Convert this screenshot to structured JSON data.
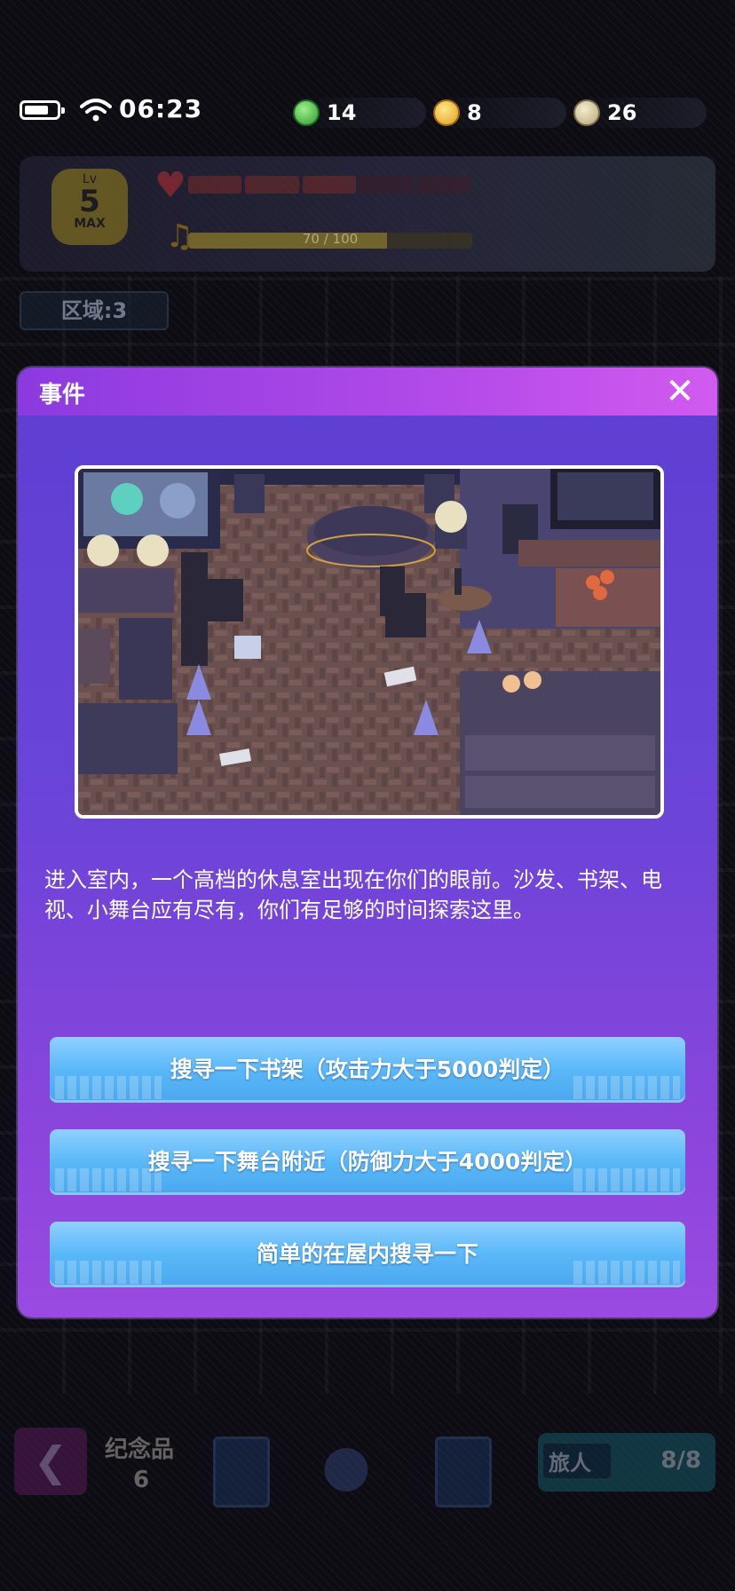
{
  "status_bar": {
    "time": "06:23",
    "resources": [
      {
        "icon": "green-leaf-coin-icon",
        "value": "14"
      },
      {
        "icon": "gold-coin-icon",
        "value": "8"
      },
      {
        "icon": "silver-coin-icon",
        "value": "26"
      }
    ]
  },
  "hud": {
    "level_prefix": "Lv",
    "level": "5",
    "level_max": "MAX",
    "hp_segments_filled": 3,
    "hp_segments_total": 5,
    "xp_text": "70 / 100",
    "xp_fraction": 0.7,
    "area_label": "区域:3"
  },
  "modal": {
    "title": "事件",
    "description": "进入室内，一个高档的休息室出现在你们的眼前。沙发、书架、电视、小舞台应有尽有，你们有足够的时间探索这里。",
    "options": [
      {
        "label": "搜寻一下书架（攻击力大于5000判定）"
      },
      {
        "label": "搜寻一下舞台附近（防御力大于4000判定）"
      },
      {
        "label": "简单的在屋内搜寻一下"
      }
    ]
  },
  "bottom_bar": {
    "souvenir_label": "纪念品",
    "souvenir_count": "6",
    "traveler_label": "旅人",
    "traveler_count": "8/8"
  },
  "colors": {
    "modal_top": "#5d3fd2",
    "modal_bottom": "#9a4ae0",
    "header_accent": "#d25af0",
    "option_button": "#5ab8f8"
  }
}
